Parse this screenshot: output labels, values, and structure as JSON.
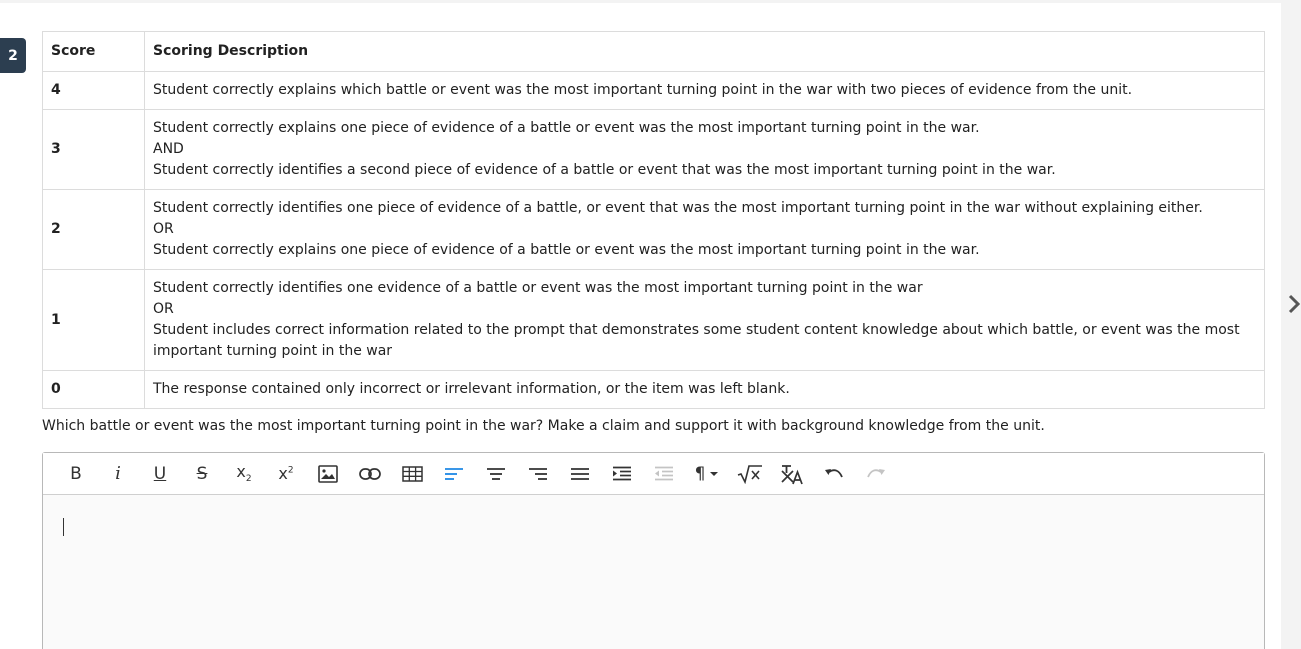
{
  "question_number": "2",
  "rubric": {
    "headers": {
      "score": "Score",
      "description": "Scoring Description"
    },
    "rows": [
      {
        "score": "4",
        "lines": [
          "Student correctly explains which battle or event was the most important turning point in the war with two pieces of evidence from the unit."
        ]
      },
      {
        "score": "3",
        "lines": [
          "Student correctly explains one piece of evidence of a battle or event was the most important turning point in the war.",
          "AND",
          "Student correctly identifies a second piece of evidence of a battle or event that was the most important turning point in the war."
        ]
      },
      {
        "score": "2",
        "lines": [
          "Student correctly identifies one piece of evidence of a battle, or event that was the most important turning point in the war without explaining either.",
          "OR",
          "Student correctly explains one piece of evidence of a battle or event was the most important turning point in the war."
        ]
      },
      {
        "score": "1",
        "lines": [
          "Student correctly identifies one evidence of a battle or event was the most important turning point in the war",
          "OR",
          "Student includes correct information related to the prompt that demonstrates some student content knowledge about which battle, or event was the most important turning point in the war"
        ]
      },
      {
        "score": "0",
        "lines": [
          "The response contained only incorrect or irrelevant information, or the item was left blank."
        ]
      }
    ]
  },
  "prompt": "Which battle or event was the most important turning point in the war? Make a claim and support it with background knowledge from the unit.",
  "toolbar": {
    "bold": "B",
    "italic": "i",
    "underline": "U",
    "strike": "S",
    "subscript": "x",
    "subscript_mark": "2",
    "superscript": "x",
    "superscript_mark": "2",
    "paragraph": "¶",
    "active_color": "#1e88e5"
  },
  "editor": {
    "value": ""
  }
}
